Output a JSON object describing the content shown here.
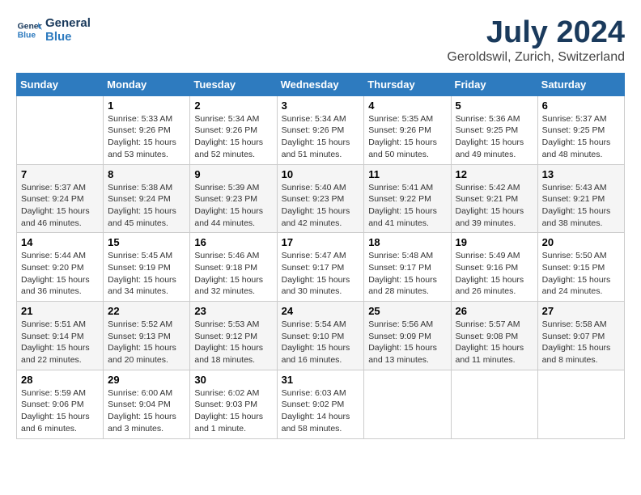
{
  "header": {
    "logo_line1": "General",
    "logo_line2": "Blue",
    "title": "July 2024",
    "subtitle": "Geroldswil, Zurich, Switzerland"
  },
  "days_of_week": [
    "Sunday",
    "Monday",
    "Tuesday",
    "Wednesday",
    "Thursday",
    "Friday",
    "Saturday"
  ],
  "weeks": [
    [
      {
        "day": "",
        "info": ""
      },
      {
        "day": "1",
        "info": "Sunrise: 5:33 AM\nSunset: 9:26 PM\nDaylight: 15 hours\nand 53 minutes."
      },
      {
        "day": "2",
        "info": "Sunrise: 5:34 AM\nSunset: 9:26 PM\nDaylight: 15 hours\nand 52 minutes."
      },
      {
        "day": "3",
        "info": "Sunrise: 5:34 AM\nSunset: 9:26 PM\nDaylight: 15 hours\nand 51 minutes."
      },
      {
        "day": "4",
        "info": "Sunrise: 5:35 AM\nSunset: 9:26 PM\nDaylight: 15 hours\nand 50 minutes."
      },
      {
        "day": "5",
        "info": "Sunrise: 5:36 AM\nSunset: 9:25 PM\nDaylight: 15 hours\nand 49 minutes."
      },
      {
        "day": "6",
        "info": "Sunrise: 5:37 AM\nSunset: 9:25 PM\nDaylight: 15 hours\nand 48 minutes."
      }
    ],
    [
      {
        "day": "7",
        "info": "Sunrise: 5:37 AM\nSunset: 9:24 PM\nDaylight: 15 hours\nand 46 minutes."
      },
      {
        "day": "8",
        "info": "Sunrise: 5:38 AM\nSunset: 9:24 PM\nDaylight: 15 hours\nand 45 minutes."
      },
      {
        "day": "9",
        "info": "Sunrise: 5:39 AM\nSunset: 9:23 PM\nDaylight: 15 hours\nand 44 minutes."
      },
      {
        "day": "10",
        "info": "Sunrise: 5:40 AM\nSunset: 9:23 PM\nDaylight: 15 hours\nand 42 minutes."
      },
      {
        "day": "11",
        "info": "Sunrise: 5:41 AM\nSunset: 9:22 PM\nDaylight: 15 hours\nand 41 minutes."
      },
      {
        "day": "12",
        "info": "Sunrise: 5:42 AM\nSunset: 9:21 PM\nDaylight: 15 hours\nand 39 minutes."
      },
      {
        "day": "13",
        "info": "Sunrise: 5:43 AM\nSunset: 9:21 PM\nDaylight: 15 hours\nand 38 minutes."
      }
    ],
    [
      {
        "day": "14",
        "info": "Sunrise: 5:44 AM\nSunset: 9:20 PM\nDaylight: 15 hours\nand 36 minutes."
      },
      {
        "day": "15",
        "info": "Sunrise: 5:45 AM\nSunset: 9:19 PM\nDaylight: 15 hours\nand 34 minutes."
      },
      {
        "day": "16",
        "info": "Sunrise: 5:46 AM\nSunset: 9:18 PM\nDaylight: 15 hours\nand 32 minutes."
      },
      {
        "day": "17",
        "info": "Sunrise: 5:47 AM\nSunset: 9:17 PM\nDaylight: 15 hours\nand 30 minutes."
      },
      {
        "day": "18",
        "info": "Sunrise: 5:48 AM\nSunset: 9:17 PM\nDaylight: 15 hours\nand 28 minutes."
      },
      {
        "day": "19",
        "info": "Sunrise: 5:49 AM\nSunset: 9:16 PM\nDaylight: 15 hours\nand 26 minutes."
      },
      {
        "day": "20",
        "info": "Sunrise: 5:50 AM\nSunset: 9:15 PM\nDaylight: 15 hours\nand 24 minutes."
      }
    ],
    [
      {
        "day": "21",
        "info": "Sunrise: 5:51 AM\nSunset: 9:14 PM\nDaylight: 15 hours\nand 22 minutes."
      },
      {
        "day": "22",
        "info": "Sunrise: 5:52 AM\nSunset: 9:13 PM\nDaylight: 15 hours\nand 20 minutes."
      },
      {
        "day": "23",
        "info": "Sunrise: 5:53 AM\nSunset: 9:12 PM\nDaylight: 15 hours\nand 18 minutes."
      },
      {
        "day": "24",
        "info": "Sunrise: 5:54 AM\nSunset: 9:10 PM\nDaylight: 15 hours\nand 16 minutes."
      },
      {
        "day": "25",
        "info": "Sunrise: 5:56 AM\nSunset: 9:09 PM\nDaylight: 15 hours\nand 13 minutes."
      },
      {
        "day": "26",
        "info": "Sunrise: 5:57 AM\nSunset: 9:08 PM\nDaylight: 15 hours\nand 11 minutes."
      },
      {
        "day": "27",
        "info": "Sunrise: 5:58 AM\nSunset: 9:07 PM\nDaylight: 15 hours\nand 8 minutes."
      }
    ],
    [
      {
        "day": "28",
        "info": "Sunrise: 5:59 AM\nSunset: 9:06 PM\nDaylight: 15 hours\nand 6 minutes."
      },
      {
        "day": "29",
        "info": "Sunrise: 6:00 AM\nSunset: 9:04 PM\nDaylight: 15 hours\nand 3 minutes."
      },
      {
        "day": "30",
        "info": "Sunrise: 6:02 AM\nSunset: 9:03 PM\nDaylight: 15 hours\nand 1 minute."
      },
      {
        "day": "31",
        "info": "Sunrise: 6:03 AM\nSunset: 9:02 PM\nDaylight: 14 hours\nand 58 minutes."
      },
      {
        "day": "",
        "info": ""
      },
      {
        "day": "",
        "info": ""
      },
      {
        "day": "",
        "info": ""
      }
    ]
  ]
}
